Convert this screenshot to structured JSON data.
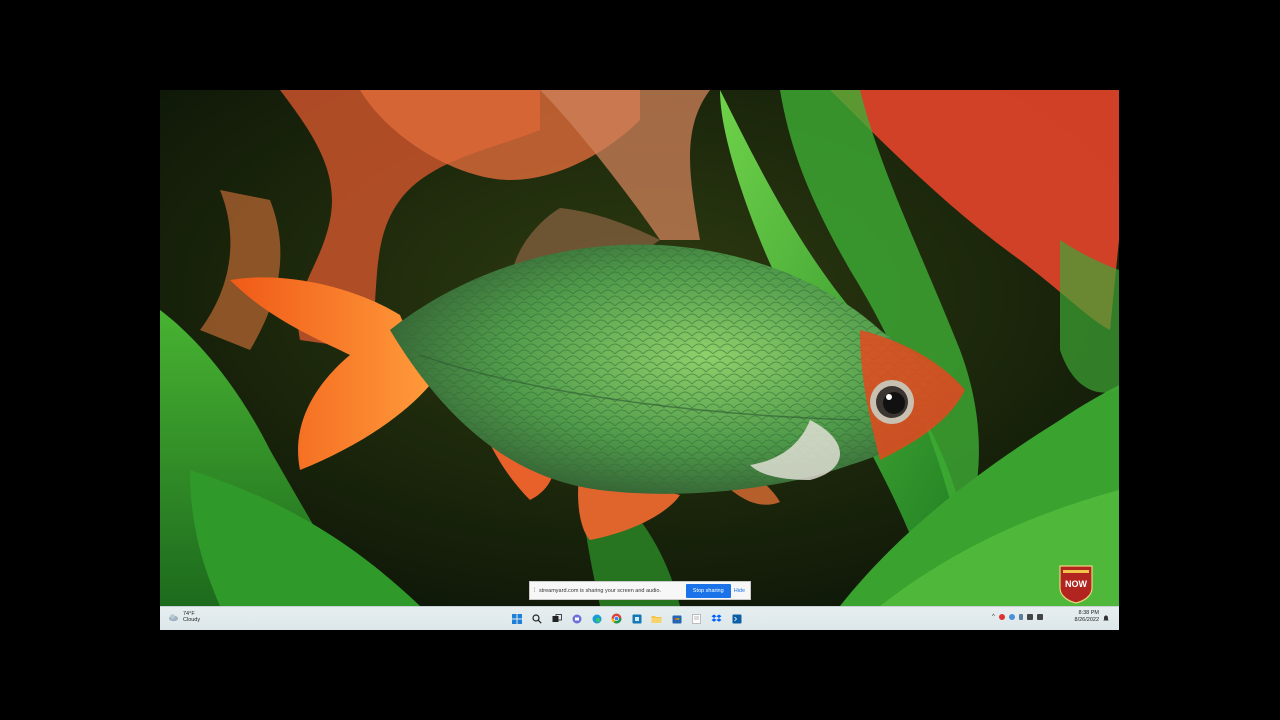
{
  "share_notice": {
    "message": "streamyard.com is sharing your screen and audio.",
    "stop_label": "Stop sharing",
    "hide_label": "Hide"
  },
  "badge": {
    "label": "NOW"
  },
  "taskbar": {
    "weather": {
      "temperature": "74°F",
      "condition": "Cloudy"
    },
    "icons": [
      "windows-start",
      "search",
      "task-view",
      "chat",
      "edge",
      "chrome",
      "sticky",
      "file-explorer",
      "store",
      "dropbox",
      "windows-terminal"
    ],
    "clock": {
      "time": "8:38 PM",
      "date": "8/26/2022"
    }
  },
  "colors": {
    "taskbar_bg": "#e6eef0",
    "accent": "#1a73e8"
  }
}
